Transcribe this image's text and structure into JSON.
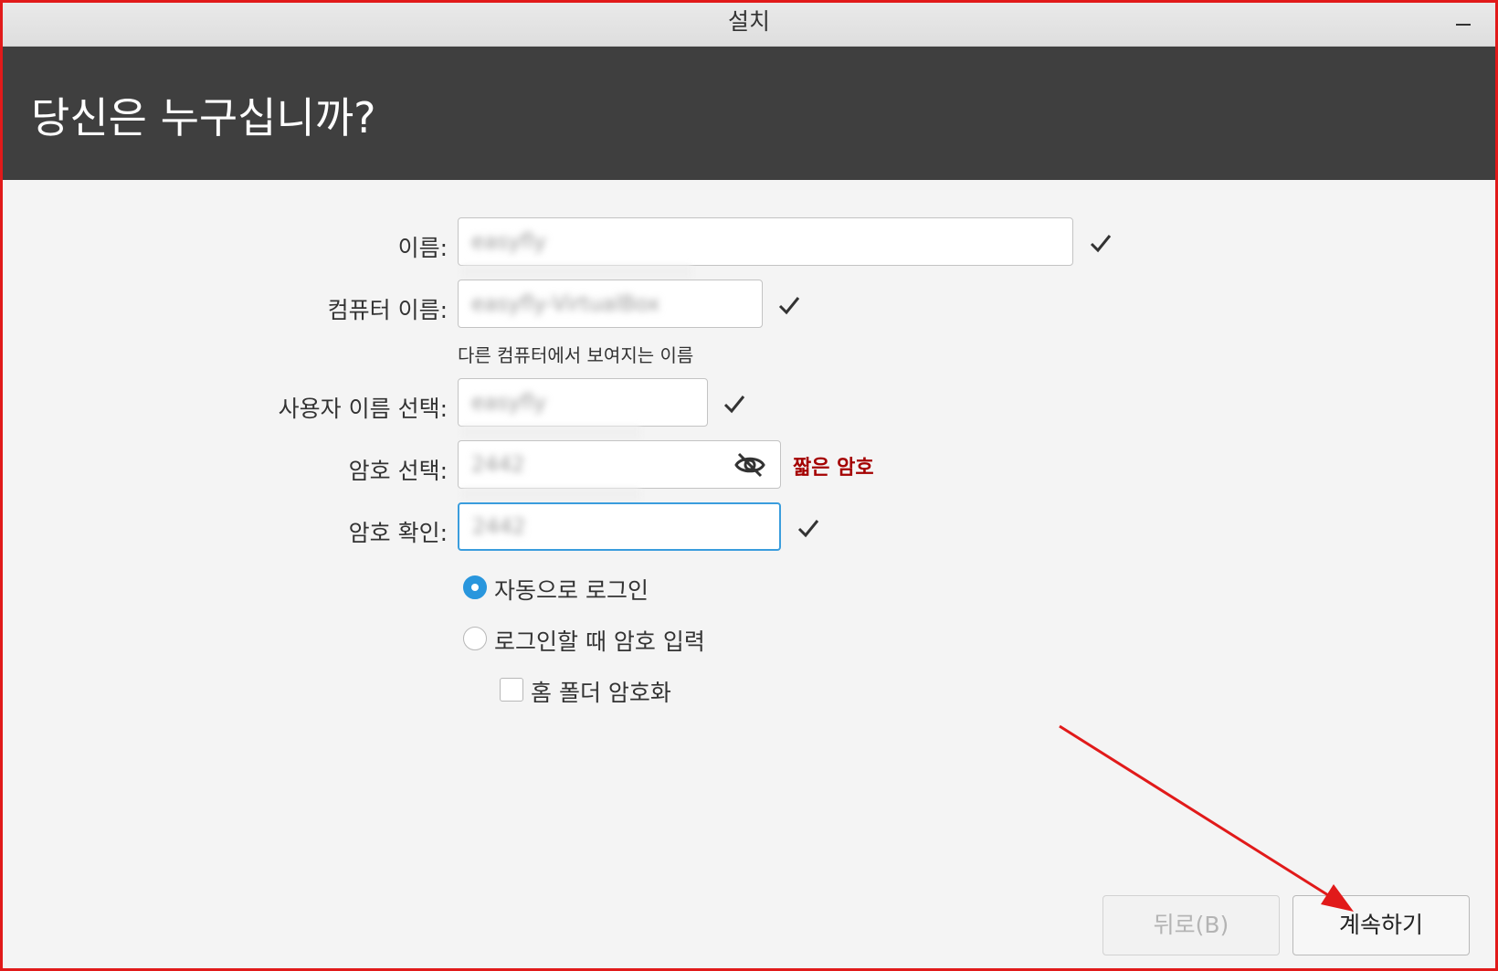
{
  "window": {
    "title": "설치"
  },
  "header": {
    "title": "당신은 누구십니까?"
  },
  "form": {
    "name": {
      "label": "이름:",
      "value": "easyfly"
    },
    "computer_name": {
      "label": "컴퓨터 이름:",
      "value": "easyfly-VirtualBox",
      "hint": "다른 컴퓨터에서 보여지는 이름"
    },
    "username": {
      "label": "사용자 이름 선택:",
      "value": "easyfly"
    },
    "password": {
      "label": "암호 선택:",
      "value": "2442",
      "warning": "짧은 암호"
    },
    "confirm": {
      "label": "암호 확인:",
      "value": "2442"
    },
    "login_options": [
      {
        "label": "자동으로 로그인",
        "checked": true
      },
      {
        "label": "로그인할 때 암호 입력",
        "checked": false
      }
    ],
    "encrypt_home": {
      "label": "홈 폴더 암호화",
      "checked": false
    }
  },
  "buttons": {
    "back": "뒤로(B)",
    "continue": "계속하기"
  },
  "colors": {
    "accent": "#2996dd",
    "warning": "#a40000",
    "header_bg": "#3f3f3f",
    "annotation": "#e11a1a"
  }
}
